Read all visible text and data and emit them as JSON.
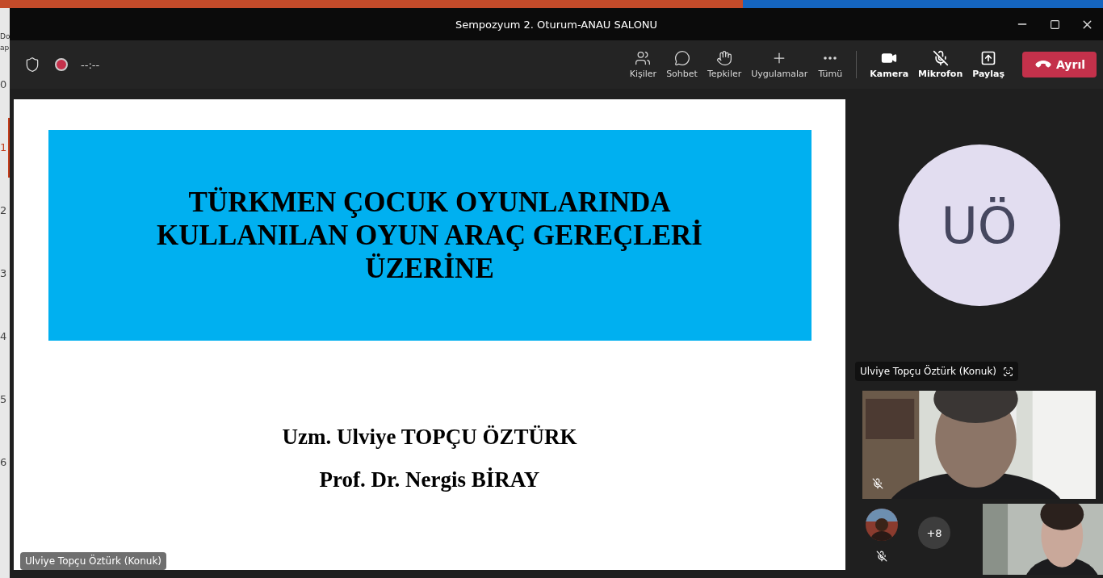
{
  "background_app": {
    "fragments": [
      "Do",
      "ap"
    ],
    "slide_numbers": [
      {
        "label": "0",
        "selected": false
      },
      {
        "label": "1",
        "selected": true
      },
      {
        "label": "2",
        "selected": false
      },
      {
        "label": "3",
        "selected": false
      },
      {
        "label": "4",
        "selected": false
      },
      {
        "label": "5",
        "selected": false
      },
      {
        "label": "6",
        "selected": false
      }
    ]
  },
  "window": {
    "title": "Sempozyum 2. Oturum-ANAU SALONU"
  },
  "toolbar": {
    "timer": "--:--",
    "buttons": [
      {
        "kind": "people",
        "label": "Kişiler"
      },
      {
        "kind": "chat",
        "label": "Sohbet"
      },
      {
        "kind": "reactions",
        "label": "Tepkiler"
      },
      {
        "kind": "apps",
        "label": "Uygulamalar"
      },
      {
        "kind": "more",
        "label": "Tümü"
      }
    ],
    "devices": [
      {
        "kind": "camera",
        "label": "Kamera",
        "on": true
      },
      {
        "kind": "microphone",
        "label": "Mikrofon",
        "on": false
      },
      {
        "kind": "share",
        "label": "Paylaş"
      }
    ],
    "leave": {
      "label": "Ayrıl"
    }
  },
  "shared_slide": {
    "title_lines": [
      "TÜRKMEN ÇOCUK OYUNLARINDA",
      "KULLANILAN OYUN ARAÇ GEREÇLERİ",
      "ÜZERİNE"
    ],
    "authors": [
      "Uzm. Ulviye TOPÇU ÖZTÜRK",
      "Prof. Dr. Nergis BİRAY"
    ],
    "presenter_label": "Ulviye Topçu Öztürk (Konuk)"
  },
  "side_panel": {
    "avatar_initials": "UÖ",
    "speaker_label": "Ulviye Topçu Öztürk (Konuk)",
    "main_video": {
      "kind": "picture",
      "muted": true
    },
    "small_avatar": {
      "muted": true
    },
    "overflow_count": "+8",
    "corner_video": {
      "kind": "picture"
    }
  }
}
